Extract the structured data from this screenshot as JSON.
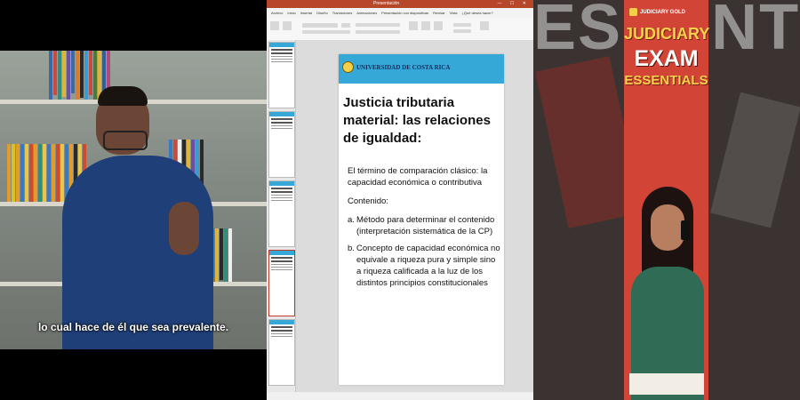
{
  "video": {
    "subtitle": "lo cual hace de él que sea prevalente."
  },
  "powerpoint": {
    "window_title": "Presentación",
    "menu": [
      "Archivo",
      "Inicio",
      "Insertar",
      "Diseño",
      "Transiciones",
      "Animaciones",
      "Presentación con diapositivas",
      "Revisar",
      "Vista",
      "¿Qué desea hacer?"
    ],
    "slide": {
      "logo_text": "UNIVERSIDAD DE COSTA RICA",
      "title": "Justicia tributaria material: las relaciones de igualdad:",
      "intro": "El término de comparación clásico: la capacidad económica o contributiva",
      "contenido_label": "Contenido:",
      "items": [
        {
          "marker": "a.",
          "text": "Método para determinar el contenido (interpretación sistemática de la CP)"
        },
        {
          "marker": "b.",
          "text": "Concepto de capacidad económica no equivale a riqueza pura y simple sino a riqueza calificada a la luz de los distintos principios constitucionales"
        }
      ]
    },
    "colors": {
      "titlebar": "#b7472a",
      "slide_header": "#35a8d8"
    }
  },
  "ad": {
    "background_text": "ESSENTIALS",
    "brand": "JUDICIARY GOLD",
    "line1": "JUDICIARY",
    "line2": "EXAM",
    "line3": "ESSENTIALS"
  }
}
